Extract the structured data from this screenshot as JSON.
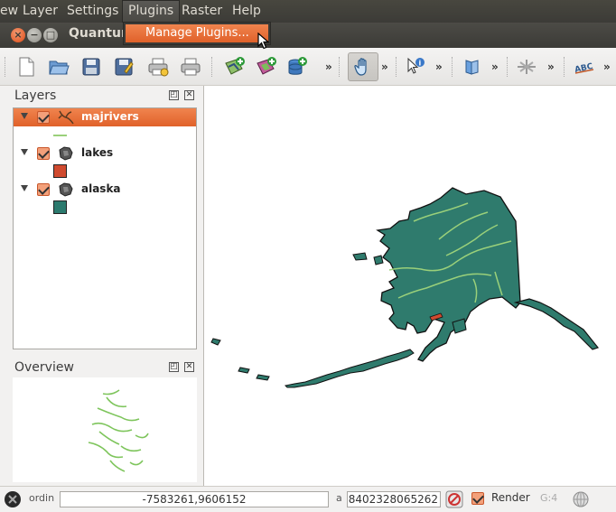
{
  "menubar": {
    "items": [
      "ew",
      "Layer",
      "Settings",
      "Plugins",
      "Raster",
      "Help"
    ],
    "active": "Plugins"
  },
  "window": {
    "title": "Quantum",
    "close": "×",
    "minimize": "−",
    "maximize": "□"
  },
  "plugins_menu": {
    "items": [
      "Manage Plugins..."
    ]
  },
  "toolbar": {
    "more": "»",
    "icons": [
      "new-project-icon",
      "open-project-icon",
      "save-project-icon",
      "save-as-icon",
      "print-composer-icon",
      "print-icon",
      "add-vector-layer-icon",
      "add-raster-layer-icon",
      "add-database-layer-icon",
      "pan-icon",
      "identify-icon",
      "map-tips-icon",
      "gps-icon",
      "label-icon"
    ],
    "active_tool": "pan-icon"
  },
  "layers_panel": {
    "title": "Layers",
    "float": "◰",
    "close": "✕",
    "layers": [
      {
        "name": "majrivers",
        "type": "line",
        "color": "#9ad07a",
        "selected": true,
        "visible": true
      },
      {
        "name": "lakes",
        "type": "polygon",
        "color": "#d04a2f",
        "selected": false,
        "visible": true
      },
      {
        "name": "alaska",
        "type": "polygon",
        "color": "#2c7a6e",
        "selected": false,
        "visible": true
      }
    ]
  },
  "overview_panel": {
    "title": "Overview",
    "float": "◰",
    "close": "✕"
  },
  "map": {
    "land_color": "#2f7b6d",
    "river_color": "#9ad07a",
    "outline_color": "#111111"
  },
  "statusbar": {
    "coord_label": "ordin",
    "coordinate": "-7583261,9606152",
    "scale_label": "a",
    "scale": "8402328065262",
    "render_label": "Render",
    "render_checked": true,
    "crs": "G:4"
  }
}
